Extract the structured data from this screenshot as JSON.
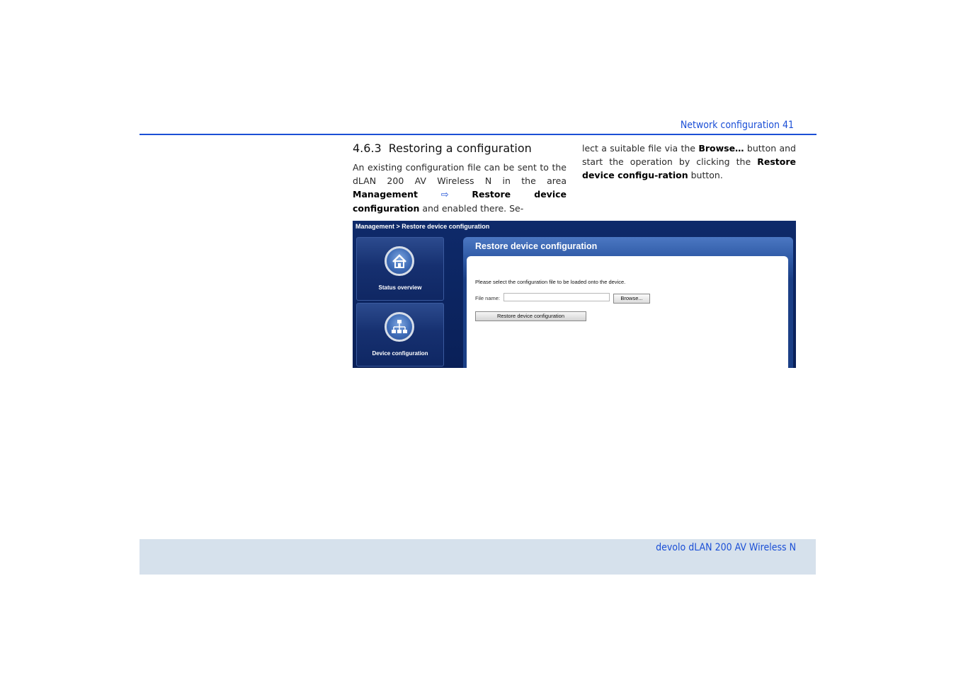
{
  "header": {
    "running_title": "Network configuration 41"
  },
  "section": {
    "number": "4.6.3",
    "title": "Restoring a configuration",
    "col1_text_1": "An existing configuration file can be sent to the dLAN 200 AV Wireless N in the area ",
    "col1_bold_1": "Management",
    "col1_arrow": "⇨",
    "col1_bold_2": "Restore device configuration",
    "col1_text_2": " and enabled there. Se-",
    "col2_text_1": "lect a suitable file via the ",
    "col2_bold_1": "Browse…",
    "col2_text_2": " button and start the operation by clicking the ",
    "col2_bold_2": "Restore device configu-ration",
    "col2_text_3": " button."
  },
  "screenshot": {
    "breadcrumb": "Management  >  Restore device configuration",
    "tiles": [
      {
        "label": "Status overview",
        "icon": "home-icon"
      },
      {
        "label": "Device configuration",
        "icon": "network-icon"
      }
    ],
    "panel_title": "Restore device configuration",
    "instruction": "Please select the configuration file to be loaded onto the device.",
    "file_name_label": "File name:",
    "file_name_value": "",
    "browse_label": "Browse...",
    "restore_label": "Restore device configuration"
  },
  "footer": {
    "product": "devolo dLAN 200 AV Wireless N"
  },
  "colors": {
    "accent": "#1b4fd6",
    "footer_bg": "#d6e1ec",
    "ui_navy": "#0e2a6a"
  }
}
